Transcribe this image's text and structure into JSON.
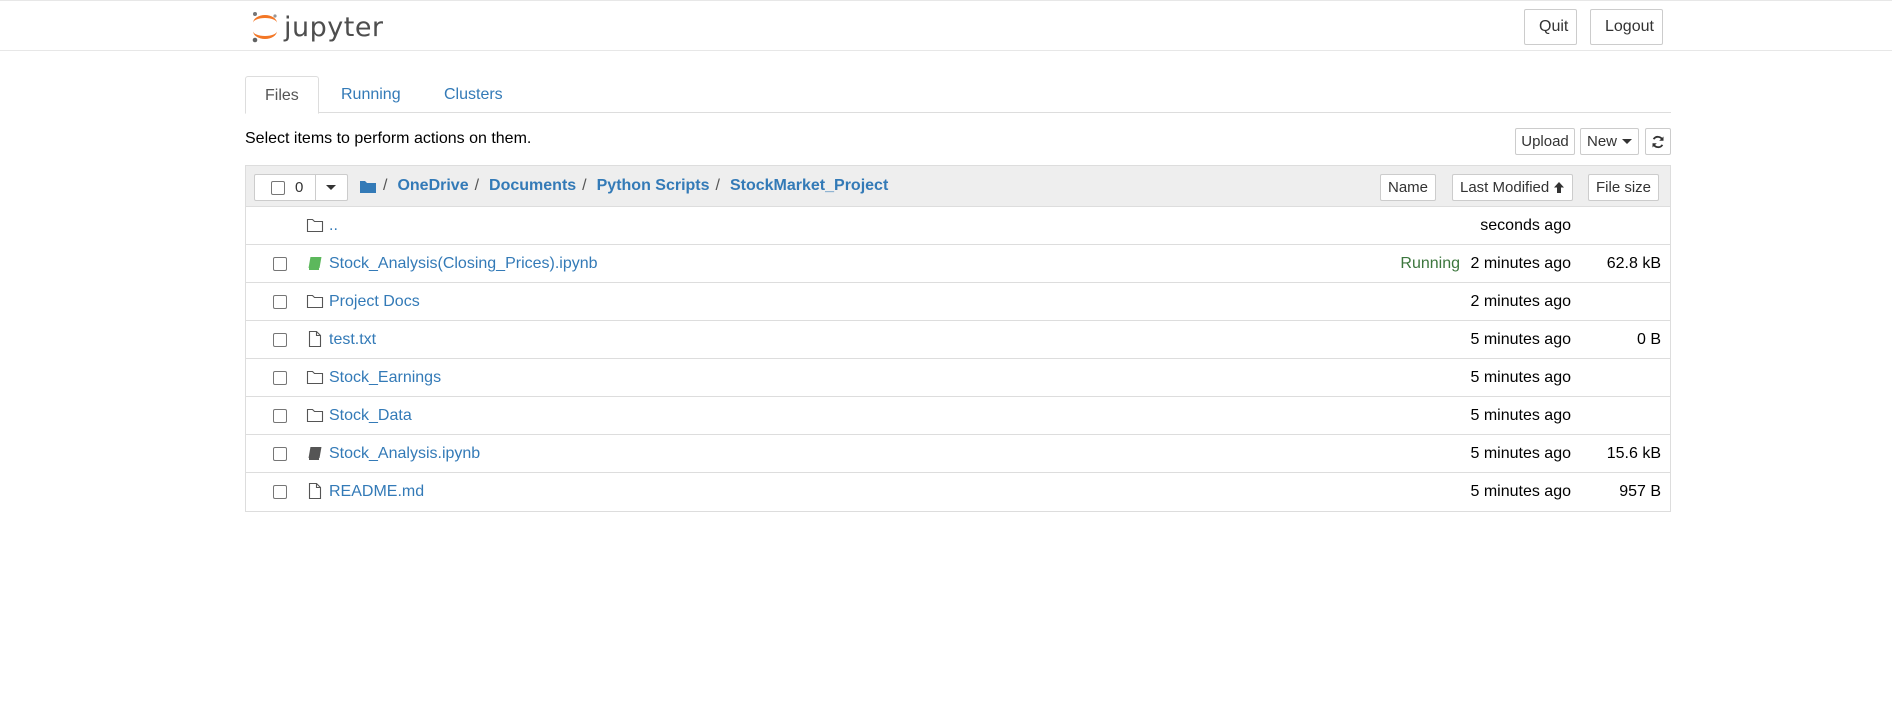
{
  "header": {
    "logo_text": "jupyter",
    "quit_label": "Quit",
    "logout_label": "Logout"
  },
  "tabs": [
    {
      "label": "Files",
      "active": true
    },
    {
      "label": "Running",
      "active": false
    },
    {
      "label": "Clusters",
      "active": false
    }
  ],
  "toolbar": {
    "instructions": "Select items to perform actions on them.",
    "upload_label": "Upload",
    "new_label": "New",
    "refresh_icon": "refresh-icon"
  },
  "list_header": {
    "selected_count": "0",
    "breadcrumb": [
      "OneDrive",
      "Documents",
      "Python Scripts",
      "StockMarket_Project"
    ],
    "sort_name_label": "Name",
    "sort_modified_label": "Last Modified",
    "sort_size_label": "File size"
  },
  "items": [
    {
      "name": "..",
      "type": "folder",
      "modified": "seconds ago",
      "size": "",
      "status": ""
    },
    {
      "name": "Stock_Analysis(Closing_Prices).ipynb",
      "type": "notebook-running",
      "modified": "2 minutes ago",
      "size": "62.8 kB",
      "status": "Running"
    },
    {
      "name": "Project Docs",
      "type": "folder",
      "modified": "2 minutes ago",
      "size": "",
      "status": ""
    },
    {
      "name": "test.txt",
      "type": "file",
      "modified": "5 minutes ago",
      "size": "0 B",
      "status": ""
    },
    {
      "name": "Stock_Earnings",
      "type": "folder",
      "modified": "5 minutes ago",
      "size": "",
      "status": ""
    },
    {
      "name": "Stock_Data",
      "type": "folder",
      "modified": "5 minutes ago",
      "size": "",
      "status": ""
    },
    {
      "name": "Stock_Analysis.ipynb",
      "type": "notebook",
      "modified": "5 minutes ago",
      "size": "15.6 kB",
      "status": ""
    },
    {
      "name": "README.md",
      "type": "file",
      "modified": "5 minutes ago",
      "size": "957 B",
      "status": ""
    }
  ],
  "colors": {
    "link": "#337ab7",
    "running": "#3c763d",
    "notebook_running": "#5cb85c",
    "logo_orange": "#f37726"
  }
}
